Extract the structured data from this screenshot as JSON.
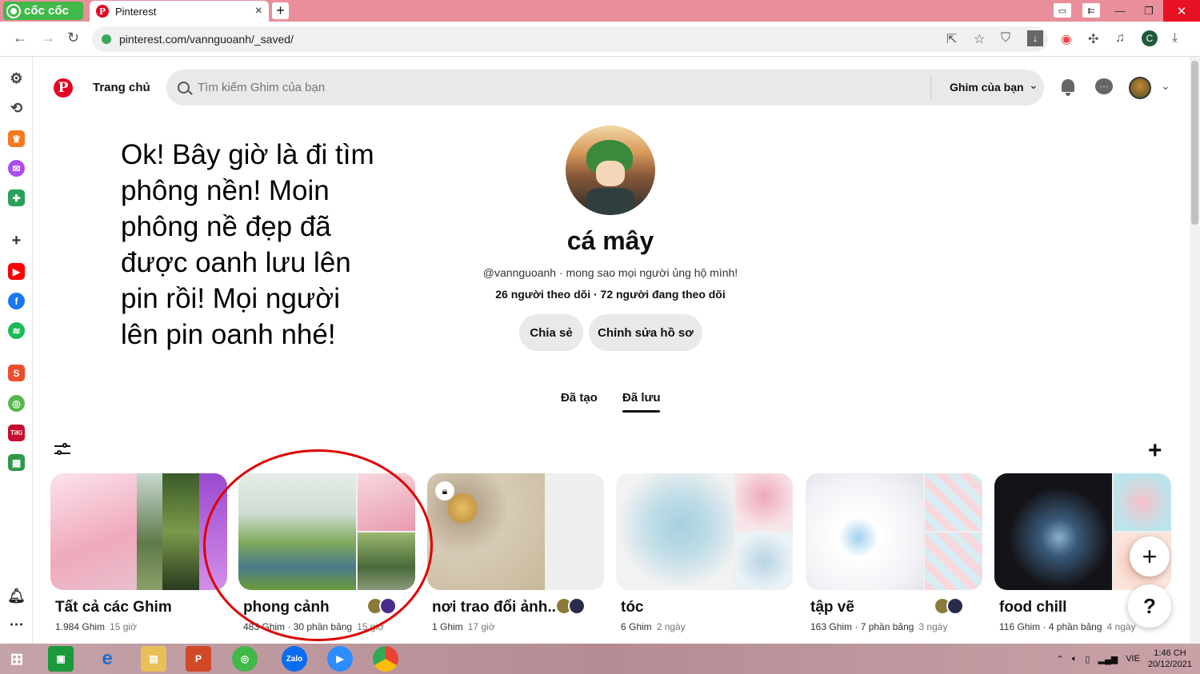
{
  "browser": {
    "brand": "cốc cốc",
    "tab_title": "Pinterest",
    "tab_close": "×",
    "new_tab": "+",
    "url": "pinterest.com/vannguoanh/_saved/"
  },
  "header": {
    "home": "Trang chủ",
    "search_placeholder": "Tìm kiếm Ghim của bạn",
    "your_pins": "Ghim của bạn"
  },
  "caption": "Ok! Bây giờ là đi tìm phông nền! Moin phông nề đẹp đã được oanh lưu lên pin rồi! Mọi người lên pin oanh nhé!",
  "profile": {
    "name": "cá mây",
    "handle": "@vannguoanh",
    "bio": "mong sao mọi người ủng hộ mình!",
    "followers": "26 người theo dõi · 72 người đang theo dõi",
    "share_label": "Chia sẻ",
    "edit_label": "Chỉnh sửa hồ sơ"
  },
  "tabs": {
    "created": "Đã tạo",
    "saved": "Đã lưu"
  },
  "boards": [
    {
      "title": "Tất cả các Ghim",
      "meta": "1.984 Ghim",
      "time": "15 giờ"
    },
    {
      "title": "phong cảnh",
      "meta": "483 Ghim · 30 phần bảng",
      "time": "15 giờ"
    },
    {
      "title": "nơi trao đổi ảnh...",
      "meta": "1 Ghim",
      "time": "17 giờ"
    },
    {
      "title": "tóc",
      "meta": "6 Ghim",
      "time": "2 ngày"
    },
    {
      "title": "tập vẽ",
      "meta": "163 Ghim · 7 phần bảng",
      "time": "3 ngày"
    },
    {
      "title": "food chill",
      "meta": "116 Ghim · 4 phần bảng",
      "time": "4 ngày"
    }
  ],
  "fab": {
    "plus": "+",
    "help": "?"
  },
  "taskbar": {
    "lang": "VIE",
    "time": "1:46 CH",
    "date": "20/12/2021"
  },
  "colors": {
    "pinterest_red": "#e60023",
    "tabbar": "#e98f9c",
    "annotation_circle": "#e00000"
  }
}
